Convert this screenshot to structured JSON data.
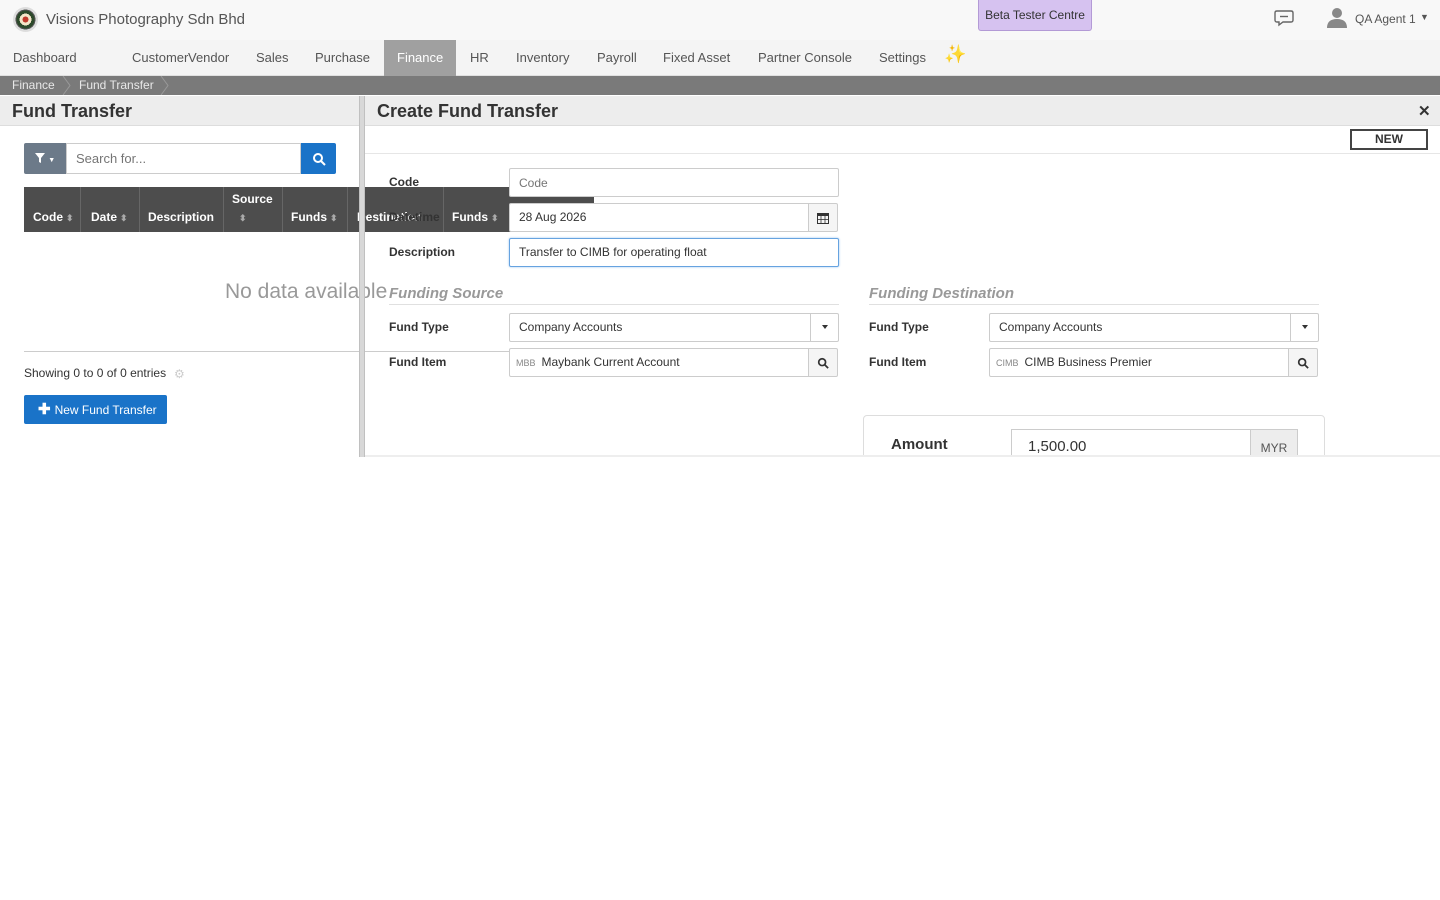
{
  "header": {
    "company": "Visions Photography Sdn Bhd",
    "beta_button": "Beta Tester Centre",
    "user_name": "QA Agent 1"
  },
  "nav": {
    "items": [
      {
        "label": "Dashboard"
      },
      {
        "label": "Customer"
      },
      {
        "label": "Vendor"
      },
      {
        "label": "Sales"
      },
      {
        "label": "Purchase"
      },
      {
        "label": "Finance",
        "active": true
      },
      {
        "label": "HR"
      },
      {
        "label": "Inventory"
      },
      {
        "label": "Payroll"
      },
      {
        "label": "Fixed Asset"
      },
      {
        "label": "Partner Console"
      },
      {
        "label": "Settings"
      }
    ],
    "sparkle_icon": "sparkle-icon"
  },
  "breadcrumb": [
    "Finance",
    "Fund Transfer"
  ],
  "list_panel": {
    "title": "Fund Transfer",
    "search_placeholder": "Search for...",
    "columns": {
      "code": "Code",
      "date": "Date",
      "description": "Description",
      "source_group": "Source",
      "source_funds": "Funds",
      "destination_group": "Destination",
      "destination_funds": "Funds"
    },
    "empty_text": "No data available",
    "showing": "Showing 0 to 0 of 0 entries",
    "new_button": "New Fund Transfer"
  },
  "form": {
    "title": "Create Fund Transfer",
    "status_badge": "NEW",
    "code_label": "Code",
    "code_placeholder": "Code",
    "datetime_label": "Datetime",
    "datetime_value": "28 Aug 2026",
    "description_label": "Description",
    "description_value": "Transfer to CIMB for operating float",
    "source": {
      "heading": "Funding Source",
      "fund_type_label": "Fund Type",
      "fund_type_value": "Company Accounts",
      "fund_item_label": "Fund Item",
      "fund_item_prefix": "MBB",
      "fund_item_value": "Maybank Current Account"
    },
    "destination": {
      "heading": "Funding Destination",
      "fund_type_label": "Fund Type",
      "fund_type_value": "Company Accounts",
      "fund_item_label": "Fund Item",
      "fund_item_prefix": "CIMB",
      "fund_item_value": "CIMB Business Premier"
    },
    "amount_label": "Amount",
    "amount_value": "1,500.00",
    "currency": "MYR"
  },
  "colors": {
    "primary": "#1a73c8",
    "nav_active": "#a0a0a0",
    "beta": "#d6c2f0",
    "table_header": "#4d4d4d"
  }
}
